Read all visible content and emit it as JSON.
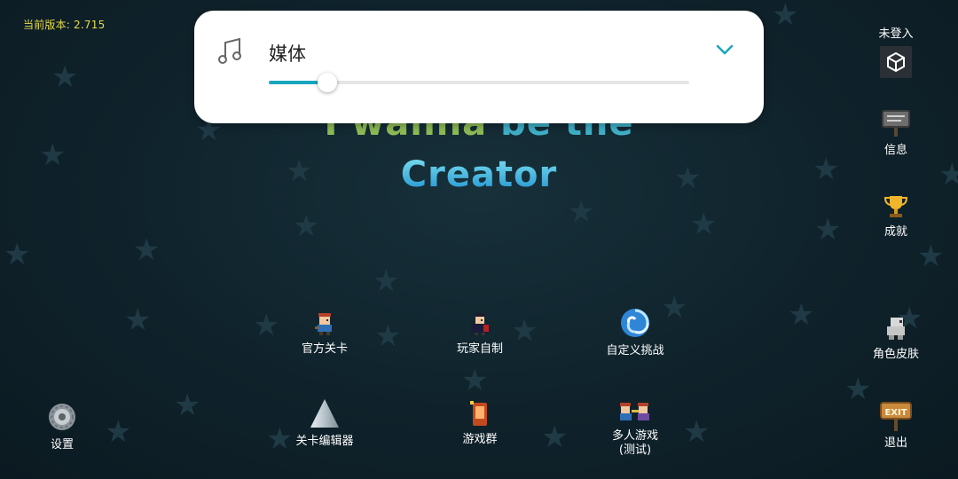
{
  "version_text": "当前版本: 2.715",
  "title": {
    "line1_part1": "I wanna",
    "line1_part2": "be the",
    "line2": "Creator"
  },
  "volume_panel": {
    "label": "媒体",
    "level_percent": 14,
    "music_icon": "music-note-icon",
    "expand_icon": "chevron-down-icon",
    "accent_color": "#19a6c0"
  },
  "account": {
    "status": "未登入",
    "icon": "unity-logo-icon"
  },
  "right_menu": {
    "info": "信息",
    "achievements": "成就",
    "skins": "角色皮肤",
    "exit": "退出"
  },
  "left_menu": {
    "settings": "设置"
  },
  "main_menu": {
    "official_levels": "官方关卡",
    "player_made": "玩家自制",
    "custom_challenge": "自定义挑战",
    "level_editor": "关卡编辑器",
    "game_group": "游戏群",
    "multiplayer_line1": "多人游戏",
    "multiplayer_line2": "(测试)"
  }
}
